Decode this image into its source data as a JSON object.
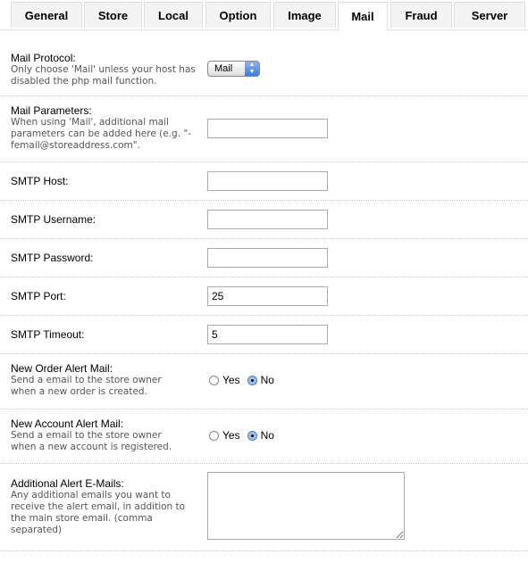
{
  "tabs": [
    "General",
    "Store",
    "Local",
    "Option",
    "Image",
    "Mail",
    "Fraud",
    "Server"
  ],
  "active_tab": "Mail",
  "fields": {
    "protocol": {
      "label": "Mail Protocol:",
      "help": "Only choose 'Mail' unless your host has disabled the php mail function.",
      "value": "Mail"
    },
    "parameters": {
      "label": "Mail Parameters:",
      "help": "When using 'Mail', additional mail parameters can be added here (e.g. \"-femail@storeaddress.com\".",
      "value": ""
    },
    "smtp_host": {
      "label": "SMTP Host:",
      "value": ""
    },
    "smtp_username": {
      "label": "SMTP Username:",
      "value": ""
    },
    "smtp_password": {
      "label": "SMTP Password:",
      "value": ""
    },
    "smtp_port": {
      "label": "SMTP Port:",
      "value": "25"
    },
    "smtp_timeout": {
      "label": "SMTP Timeout:",
      "value": "5"
    },
    "order_alert": {
      "label": "New Order Alert Mail:",
      "help": "Send a email to the store owner when a new order is created.",
      "yes": "Yes",
      "no": "No",
      "selected": "No"
    },
    "account_alert": {
      "label": "New Account Alert Mail:",
      "help": "Send a email to the store owner when a new account is registered.",
      "yes": "Yes",
      "no": "No",
      "selected": "No"
    },
    "alert_emails": {
      "label": "Additional Alert E-Mails:",
      "help": "Any additional emails you want to receive the alert email, in addition to the main store email. (comma separated)",
      "value": ""
    }
  }
}
